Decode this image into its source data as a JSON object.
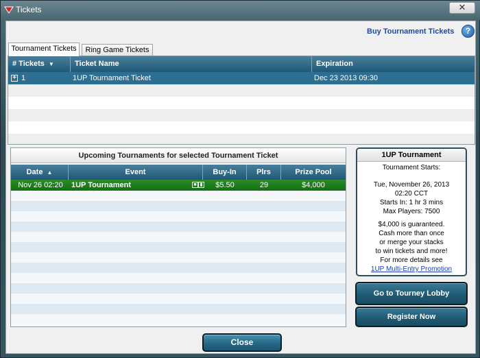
{
  "window": {
    "title": "Tickets"
  },
  "header": {
    "buy_link": "Buy Tournament Tickets",
    "help_label": "?"
  },
  "tabs": [
    {
      "label": "Tournament Tickets",
      "active": true
    },
    {
      "label": "Ring Game Tickets",
      "active": false
    }
  ],
  "tickets_table": {
    "columns": [
      "# Tickets",
      "Ticket Name",
      "Expiration"
    ],
    "rows": [
      {
        "count": "1",
        "name": "1UP Tournament Ticket",
        "expiration": "Dec 23 2013 09:30"
      }
    ]
  },
  "upcoming": {
    "title": "Upcoming Tournaments for selected Tournament Ticket",
    "columns": [
      "Date",
      "Event",
      "Buy-In",
      "Plrs",
      "Prize Pool"
    ],
    "rows": [
      {
        "date": "Nov 26 02:20",
        "event": "1UP Tournament",
        "buyin": "$5.50",
        "players": "29",
        "prize": "$4,000"
      }
    ]
  },
  "info": {
    "title": "1UP Tournament",
    "starts_label": "Tournament Starts:",
    "date_line": "Tue, November 26, 2013",
    "time_line": "02:20 CCT",
    "starts_in": "Starts In: 1 hr 3 mins",
    "max_players": "Max Players: 7500",
    "promo_1": "$4,000 is guaranteed.",
    "promo_2": "Cash more than once",
    "promo_3": "or merge your stacks",
    "promo_4": "to win tickets and more!",
    "promo_5": "For more details see",
    "promo_link": "1UP Multi-Entry Promotion"
  },
  "buttons": {
    "tourney_lobby": "Go to Tourney Lobby",
    "register": "Register Now",
    "close": "Close"
  },
  "colors": {
    "header_blue": "#1e5878",
    "selected_row": "#2c6f93",
    "highlight_green": "#137011",
    "link": "#1f4a9a"
  }
}
